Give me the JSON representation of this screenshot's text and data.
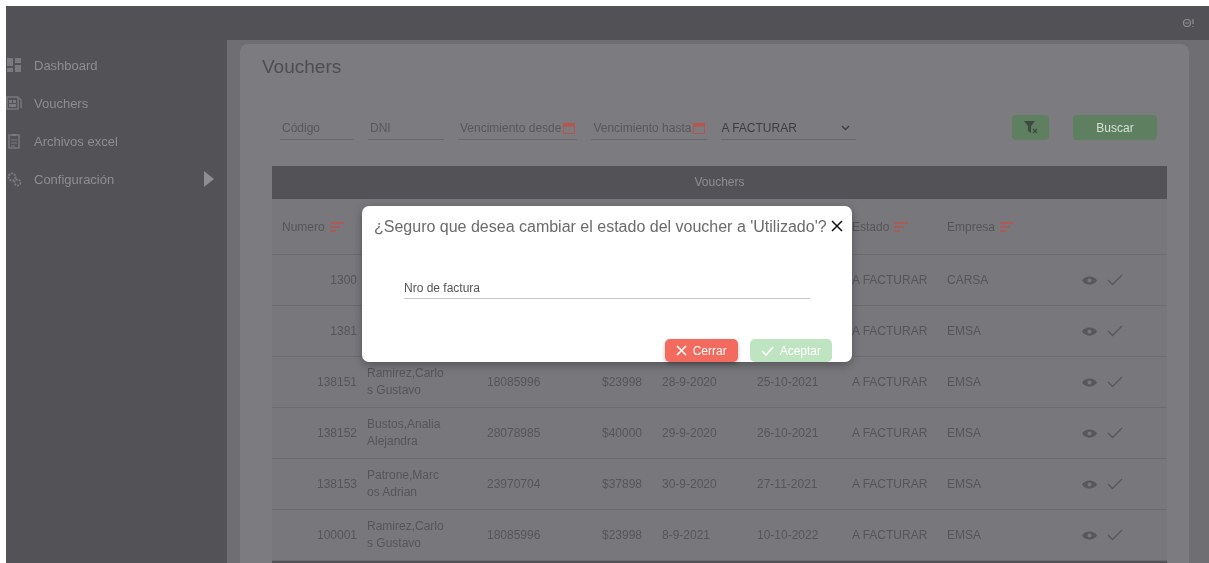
{
  "sidebar": {
    "items": [
      {
        "label": "Dashboard",
        "expandable": false
      },
      {
        "label": "Vouchers",
        "expandable": false
      },
      {
        "label": "Archivos excel",
        "expandable": false
      },
      {
        "label": "Configuración",
        "expandable": true
      }
    ]
  },
  "page_title": "Vouchers",
  "filters": {
    "fields": [
      {
        "placeholder": "Código",
        "calendar": false
      },
      {
        "placeholder": "DNI",
        "calendar": false
      },
      {
        "placeholder": "Vencimiento desde",
        "calendar": true
      },
      {
        "placeholder": "Vencimiento hasta",
        "calendar": true
      }
    ],
    "status_select": "A FACTURAR",
    "search_button": "Buscar"
  },
  "table": {
    "title": "Vouchers",
    "columns": [
      {
        "label": "Numero",
        "sortable": true
      },
      {
        "label": "Estado",
        "sortable": true
      },
      {
        "label": "Empresa",
        "sortable": true
      }
    ],
    "rows": [
      {
        "numero": "1300",
        "estado": "A FACTURAR",
        "empresa": "CARSA"
      },
      {
        "numero": "1381",
        "estado": "A FACTURAR",
        "empresa": "EMSA"
      },
      {
        "numero": "138151",
        "nombre": "Ramirez,Carlo s Gustavo",
        "dni": "18085996",
        "importe": "$23998",
        "desde": "28-9-2020",
        "hasta": "25-10-2021",
        "estado": "A FACTURAR",
        "empresa": "EMSA"
      },
      {
        "numero": "138152",
        "nombre": "Bustos,Analia Alejandra",
        "dni": "28078985",
        "importe": "$40000",
        "desde": "29-9-2020",
        "hasta": "26-10-2021",
        "estado": "A FACTURAR",
        "empresa": "EMSA"
      },
      {
        "numero": "138153",
        "nombre": "Patrone,Marc os Adrian",
        "dni": "23970704",
        "importe": "$37898",
        "desde": "30-9-2020",
        "hasta": "27-11-2021",
        "estado": "A FACTURAR",
        "empresa": "EMSA"
      },
      {
        "numero": "100001",
        "nombre": "Ramirez,Carlo s Gustavo",
        "dni": "18085996",
        "importe": "$23998",
        "desde": "8-9-2021",
        "hasta": "10-10-2022",
        "estado": "A FACTURAR",
        "empresa": "EMSA"
      }
    ]
  },
  "dialog": {
    "title": "¿Seguro que desea cambiar el estado del voucher a 'Utilizado'?",
    "field_placeholder": "Nro de factura",
    "buttons": [
      {
        "label": "Cerrar",
        "kind": "close",
        "disabled": false
      },
      {
        "label": "Aceptar",
        "kind": "accept",
        "disabled": true
      }
    ]
  }
}
